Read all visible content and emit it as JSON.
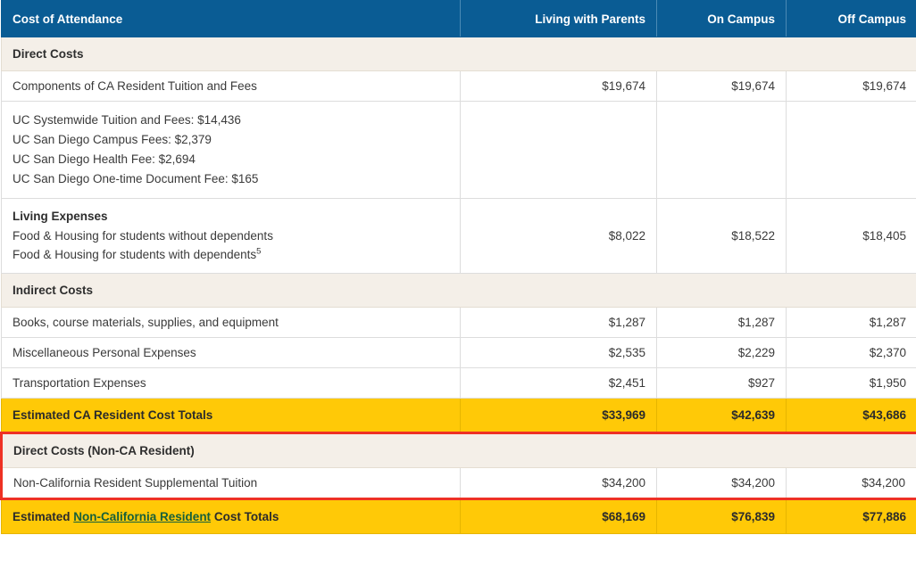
{
  "table": {
    "headers": {
      "label": "Cost of Attendance",
      "columns": [
        "Living with Parents",
        "On Campus",
        "Off Campus"
      ]
    },
    "sections": {
      "direct_costs": "Direct Costs",
      "indirect_costs": "Indirect Costs",
      "direct_costs_non_ca": "Direct Costs (Non-CA Resident)"
    },
    "rows": {
      "components": {
        "label": "Components of CA Resident Tuition and Fees",
        "values": [
          "$19,674",
          "$19,674",
          "$19,674"
        ]
      },
      "breakdown": {
        "lines": [
          "UC Systemwide Tuition and Fees: $14,436",
          "UC San Diego Campus Fees: $2,379",
          "UC San Diego Health Fee: $2,694",
          "UC San Diego One-time Document Fee: $165"
        ],
        "values": [
          "",
          "",
          ""
        ]
      },
      "living_expenses": {
        "heading": "Living Expenses",
        "line1": "Food & Housing for students without dependents",
        "line2": "Food & Housing for students with dependents",
        "line2_sup": "5",
        "values": [
          "$8,022",
          "$18,522",
          "$18,405"
        ]
      },
      "books": {
        "label": "Books, course materials, supplies, and equipment",
        "values": [
          "$1,287",
          "$1,287",
          "$1,287"
        ]
      },
      "misc": {
        "label": "Miscellaneous Personal Expenses",
        "values": [
          "$2,535",
          "$2,229",
          "$2,370"
        ]
      },
      "transportation": {
        "label": "Transportation Expenses",
        "values": [
          "$2,451",
          "$927",
          "$1,950"
        ]
      },
      "ca_totals": {
        "label": "Estimated CA Resident Cost Totals",
        "values": [
          "$33,969",
          "$42,639",
          "$43,686"
        ]
      },
      "non_ca_tuition": {
        "label": "Non-California Resident Supplemental Tuition",
        "values": [
          "$34,200",
          "$34,200",
          "$34,200"
        ]
      },
      "non_ca_totals": {
        "label_before": "Estimated",
        "label_link": "Non-California Resident",
        "label_after": "Cost Totals",
        "values": [
          "$68,169",
          "$76,839",
          "$77,886"
        ]
      }
    }
  },
  "colors": {
    "header_blue": "#0a5c94",
    "section_beige": "#f4efe8",
    "total_yellow": "#ffc907",
    "highlight_red": "#ee3124",
    "link_green": "#17603a"
  }
}
